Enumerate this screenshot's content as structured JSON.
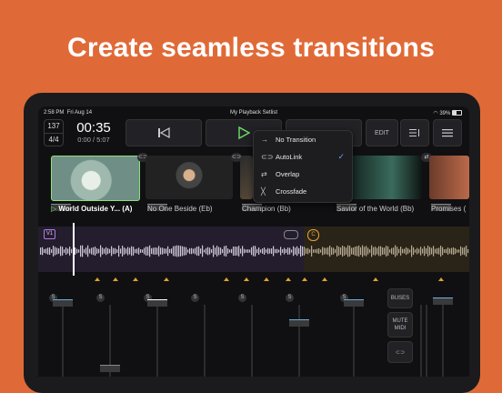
{
  "headline": "Create seamless transitions",
  "status": {
    "time": "2:58 PM",
    "date": "Fri Aug 14",
    "title": "My Playback Setlist",
    "battery": "39%"
  },
  "toolbar": {
    "bpm": "137",
    "signature": "4/4",
    "time": "00:35",
    "elapsed": "0:00 / 5:07",
    "edit_label": "EDIT"
  },
  "icons": {
    "prev": "skip-back-icon",
    "play": "play-icon",
    "setlist": "setlist-icon",
    "menu": "hamburger-icon",
    "link": "link-icon"
  },
  "transition_menu": {
    "items": [
      {
        "label": "No Transition",
        "icon": "arrow-right-icon",
        "selected": false
      },
      {
        "label": "AutoLink",
        "icon": "link-icon",
        "selected": true
      },
      {
        "label": "Overlap",
        "icon": "overlap-icon",
        "selected": false
      },
      {
        "label": "Crossfade",
        "icon": "crossfade-icon",
        "selected": false
      }
    ]
  },
  "tracks": [
    {
      "title": "World Outside Y...  (A)",
      "playing": true
    },
    {
      "title": "No One Beside (Eb)"
    },
    {
      "title": "Champion (Bb)"
    },
    {
      "title": "Savior of the World (Bb)"
    },
    {
      "title": "Promises ("
    }
  ],
  "waveform": {
    "current_badge": "V1",
    "next_badge": "C"
  },
  "mixer": {
    "solo_label": "S",
    "buses_label": "BUSES",
    "mute_midi_label": "MUTE MIDI"
  },
  "colors": {
    "background": "#e06a37",
    "accent_green": "#8ee07a",
    "accent_blue": "#5aa0ff",
    "marker": "#e0a030"
  }
}
